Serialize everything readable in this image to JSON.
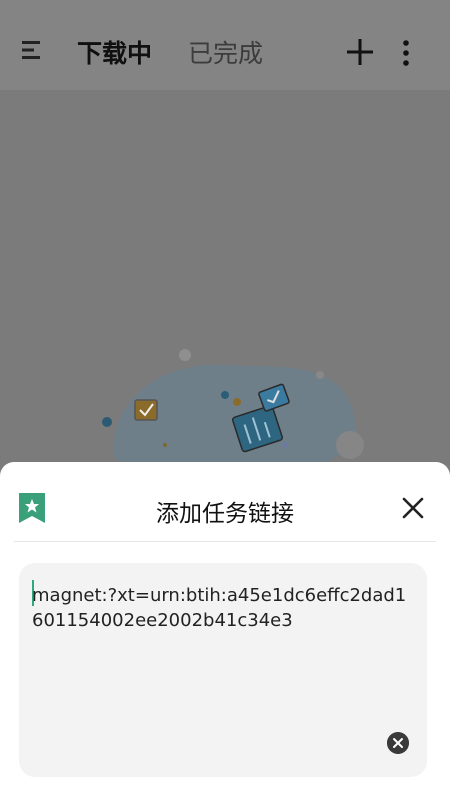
{
  "appbar": {
    "menu_icon": "menu-icon",
    "tabs": [
      {
        "label": "下载中",
        "active": true
      },
      {
        "label": "已完成",
        "active": false
      }
    ],
    "add_icon": "plus-icon",
    "more_icon": "more-vert-icon"
  },
  "empty_state": {
    "illustration": "empty-download-illustration"
  },
  "sheet": {
    "icon": "bookmark-icon",
    "title": "添加任务链接",
    "close_icon": "close-icon",
    "link_input": {
      "value": "magnet:?xt=urn:btih:a45e1dc6effc2dad1601154002ee2002b41c34e3"
    },
    "clear_icon": "clear-circle-icon"
  },
  "colors": {
    "accent": "#2ea882",
    "overlay": "#7c7c7c",
    "sheet_bg": "#ffffff",
    "input_bg": "#f3f3f3"
  }
}
